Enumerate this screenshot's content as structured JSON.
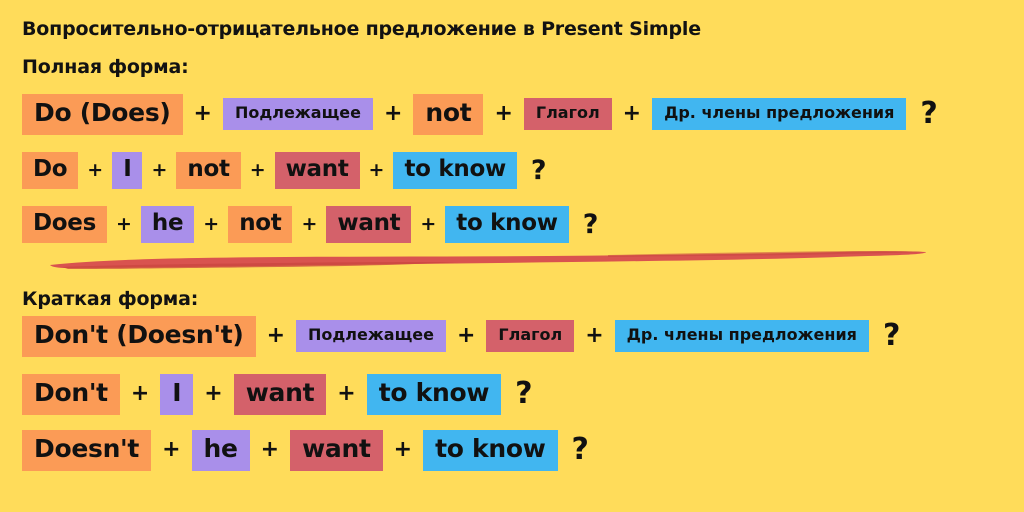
{
  "page": {
    "background_color": "#FFDC5A",
    "title": "Вопросительно-отрицательное предложение в Present Simple"
  },
  "colors": {
    "orange": "#FB9B56",
    "purple": "#A98FEA",
    "red": "#D4616A",
    "blue": "#41B6F0",
    "divider": "#D9534F",
    "text": "#111111"
  },
  "sections": {
    "full": {
      "label": "Полная форма:",
      "pattern": {
        "aux": "Do (Does)",
        "subject": "Подлежащее",
        "negation": "not",
        "verb": "Глагол",
        "rest": "Др. члены предложения",
        "end": "?"
      },
      "examples": [
        {
          "aux": "Do",
          "subject": "I",
          "negation": "not",
          "verb": "want",
          "rest": "to know",
          "end": "?"
        },
        {
          "aux": "Does",
          "subject": "he",
          "negation": "not",
          "verb": "want",
          "rest": "to know",
          "end": "?"
        }
      ]
    },
    "short": {
      "label": "Краткая форма:",
      "pattern": {
        "aux": "Don't (Doesn't)",
        "subject": "Подлежащее",
        "verb": "Глагол",
        "rest": "Др. члены предложения",
        "end": "?"
      },
      "examples": [
        {
          "aux": "Don't",
          "subject": "I",
          "verb": "want",
          "rest": "to know",
          "end": "?"
        },
        {
          "aux": "Doesn't",
          "subject": "he",
          "verb": "want",
          "rest": "to know",
          "end": "?"
        }
      ]
    }
  },
  "separator": {
    "plus": "+"
  }
}
